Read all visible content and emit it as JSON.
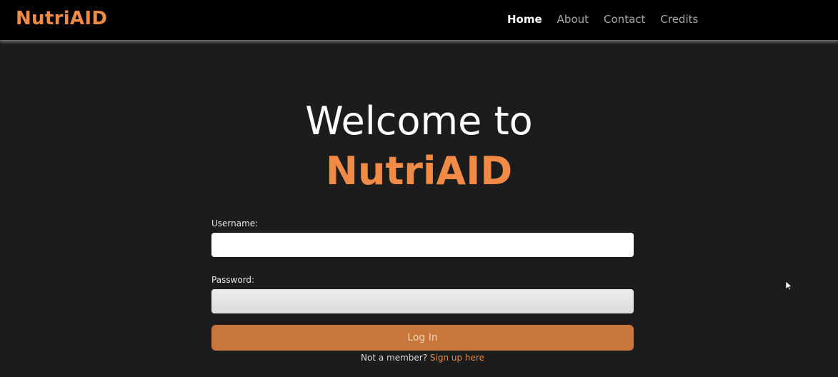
{
  "nav": {
    "brand": "NutriAID",
    "links": [
      {
        "label": "Home",
        "active": true
      },
      {
        "label": "About",
        "active": false
      },
      {
        "label": "Contact",
        "active": false
      },
      {
        "label": "Credits",
        "active": false
      }
    ]
  },
  "hero": {
    "line1": "Welcome to",
    "line2": "NutriAID"
  },
  "form": {
    "username_label": "Username:",
    "username_value": "",
    "password_label": "Password:",
    "password_value": "",
    "login_label": "Log In",
    "signup_prompt": "Not a member?",
    "signup_link": "Sign up here"
  },
  "colors": {
    "accent": "#f08a45",
    "button": "#c8763c",
    "navbar": "#000000",
    "background": "#1c1c1c"
  },
  "icons": {
    "cursor": "mouse-pointer-icon"
  }
}
